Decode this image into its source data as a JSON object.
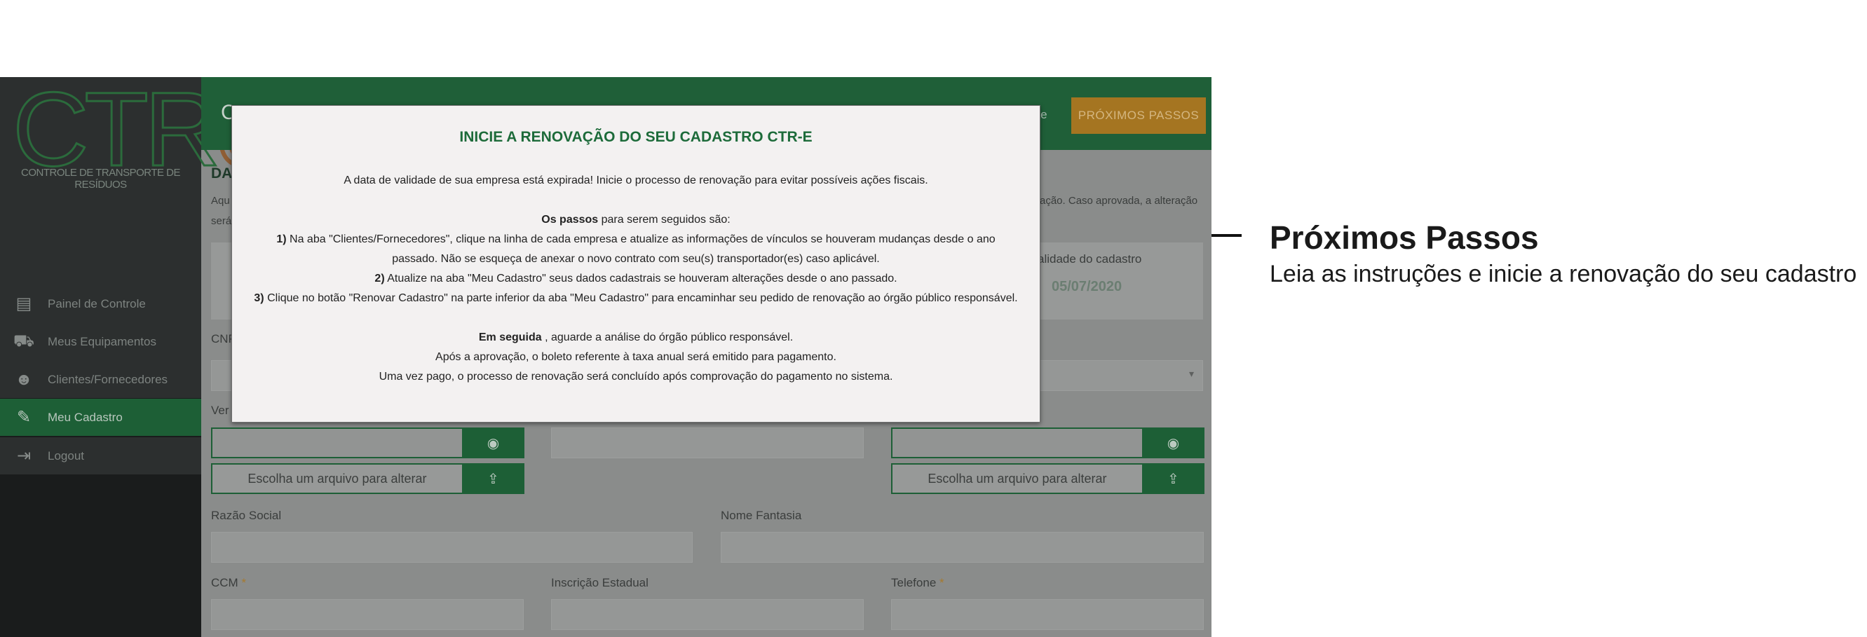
{
  "brand": {
    "logo_text": "CTR-E",
    "tagline": "CONTROLE DE TRANSPORTE DE RESÍDUOS"
  },
  "sidebar": {
    "items": [
      {
        "label": "Painel de Controle",
        "icon": "dashboard-icon"
      },
      {
        "label": "Meus Equipamentos",
        "icon": "truck-icon"
      },
      {
        "label": "Clientes/Fornecedores",
        "icon": "users-icon"
      },
      {
        "label": "Meu Cadastro",
        "icon": "edit-icon",
        "active": true
      },
      {
        "label": "Logout",
        "icon": "logout-icon"
      }
    ]
  },
  "header": {
    "initial": "C",
    "help_fragment": "nte",
    "next_steps_button": "PRÓXIMOS PASSOS"
  },
  "content": {
    "section_fragment": "DA",
    "intro_fragment_left": "Aqu",
    "intro_fragment_left2": "será",
    "intro_fragment_right": "ação. Caso aprovada, a alteração",
    "validity_label": "alidade do cadastro",
    "validity_date": "05/07/2020",
    "cnpj_fragment": "CNP",
    "ver_fragment": "Ver",
    "upload_label": "Escolha um arquivo para alterar",
    "razao_social_label": "Razão Social",
    "nome_fantasia_label": "Nome Fantasia",
    "ccm_label": "CCM",
    "inscricao_label": "Inscrição Estadual",
    "telefone_label": "Telefone",
    "required_mark": "*"
  },
  "modal": {
    "title": "INICIE A RENOVAÇÃO DO SEU CADASTRO CTR-E",
    "expired_notice": "A data de validade de sua empresa está expirada! Inicie o processo de renovação para evitar possíveis ações fiscais.",
    "steps_intro_bold": "Os passos",
    "steps_intro_rest": " para serem seguidos são:",
    "step1_num": "1)",
    "step1_a": " Na aba \"Clientes/Fornecedores\", clique na linha de cada empresa e atualize as informações de vínculos se houveram mudanças desde o ano",
    "step1_b": "passado. Não se esqueça de anexar o novo contrato com seu(s) transportador(es) caso aplicável.",
    "step2_num": "2)",
    "step2": " Atualize na aba \"Meu Cadastro\" seus dados cadastrais se houveram alterações desde o ano passado.",
    "step3_num": "3)",
    "step3": " Clique no botão \"Renovar Cadastro\" na parte inferior da aba \"Meu Cadastro\" para encaminhar seu pedido de renovação ao órgão público responsável.",
    "next_bold": "Em seguida",
    "next_rest": " , aguarde a análise do órgão público responsável.",
    "approval_line": "Após a aprovação, o boleto referente à taxa anual será emitido para pagamento.",
    "payment_line": "Uma vez pago, o processo de renovação será concluído após comprovação do pagamento no sistema."
  },
  "annotation": {
    "title": "Próximos Passos",
    "subtitle": "Leia as instruções e inicie a renovação do seu cadastro"
  },
  "colors": {
    "brand_green": "#1d5f36",
    "accent_orange": "#a57521",
    "modal_title_green": "#1d6b3a"
  }
}
